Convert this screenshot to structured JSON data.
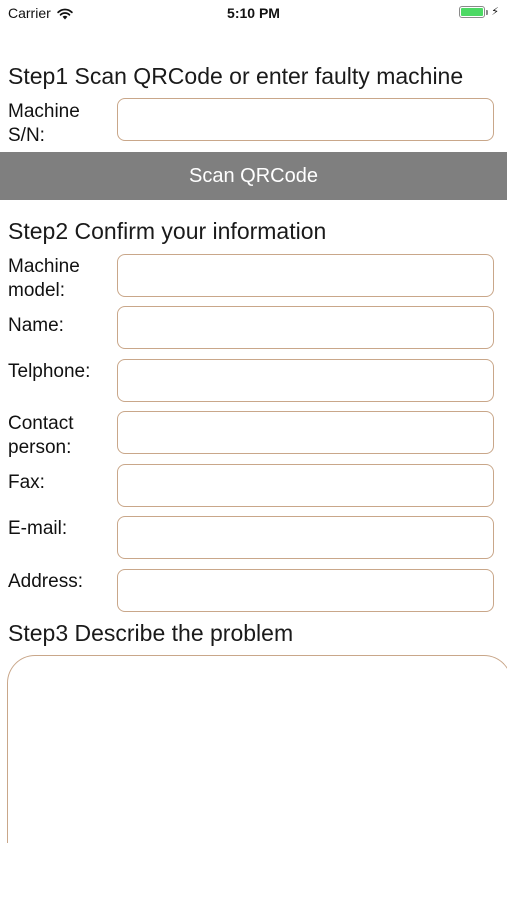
{
  "status_bar": {
    "carrier": "Carrier",
    "time": "5:10 PM",
    "battery_level": 1.0,
    "icons": [
      "wifi-icon",
      "battery-icon",
      "charging-bolt-icon"
    ]
  },
  "step1": {
    "heading": "Step1 Scan QRCode or enter faulty machine",
    "fields": [
      {
        "label": "Machine S/N:",
        "value": "",
        "placeholder": ""
      }
    ],
    "scan_button_label": "Scan QRCode"
  },
  "step2": {
    "heading": "Step2 Confirm your information",
    "fields": [
      {
        "label": "Machine model:",
        "value": "",
        "placeholder": ""
      },
      {
        "label": "Name:",
        "value": "",
        "placeholder": ""
      },
      {
        "label": "Telphone:",
        "value": "",
        "placeholder": ""
      },
      {
        "label": "Contact person:",
        "value": "",
        "placeholder": ""
      },
      {
        "label": "Fax:",
        "value": "",
        "placeholder": ""
      },
      {
        "label": "E-mail:",
        "value": "",
        "placeholder": ""
      },
      {
        "label": "Address:",
        "value": "",
        "placeholder": ""
      }
    ]
  },
  "step3": {
    "heading": "Step3 Describe the problem",
    "description_value": ""
  },
  "colors": {
    "button_background": "#7f7f7f",
    "button_text": "#ffffff",
    "input_border": "#c9a78a",
    "battery_fill": "#4cd964"
  }
}
